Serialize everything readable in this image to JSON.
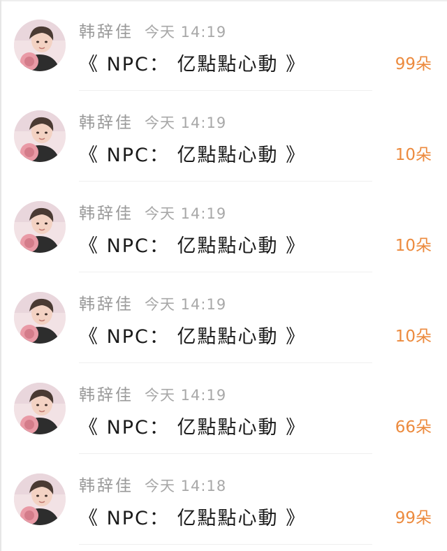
{
  "colors": {
    "accent": "#ec8a3d",
    "secondary_text": "#999999",
    "primary_text": "#1a1a1a"
  },
  "gift_list": {
    "items": [
      {
        "name": "韩辞佳",
        "time": "今天 14:19",
        "message": "《 NPC： 亿點點心動 》",
        "amount": "99朵"
      },
      {
        "name": "韩辞佳",
        "time": "今天 14:19",
        "message": "《 NPC： 亿點點心動 》",
        "amount": "10朵"
      },
      {
        "name": "韩辞佳",
        "time": "今天 14:19",
        "message": "《 NPC： 亿點點心動 》",
        "amount": "10朵"
      },
      {
        "name": "韩辞佳",
        "time": "今天 14:19",
        "message": "《 NPC： 亿點點心動 》",
        "amount": "10朵"
      },
      {
        "name": "韩辞佳",
        "time": "今天 14:19",
        "message": "《 NPC： 亿點點心動 》",
        "amount": "66朵"
      },
      {
        "name": "韩辞佳",
        "time": "今天 14:18",
        "message": "《 NPC： 亿點點心動 》",
        "amount": "99朵"
      }
    ]
  }
}
